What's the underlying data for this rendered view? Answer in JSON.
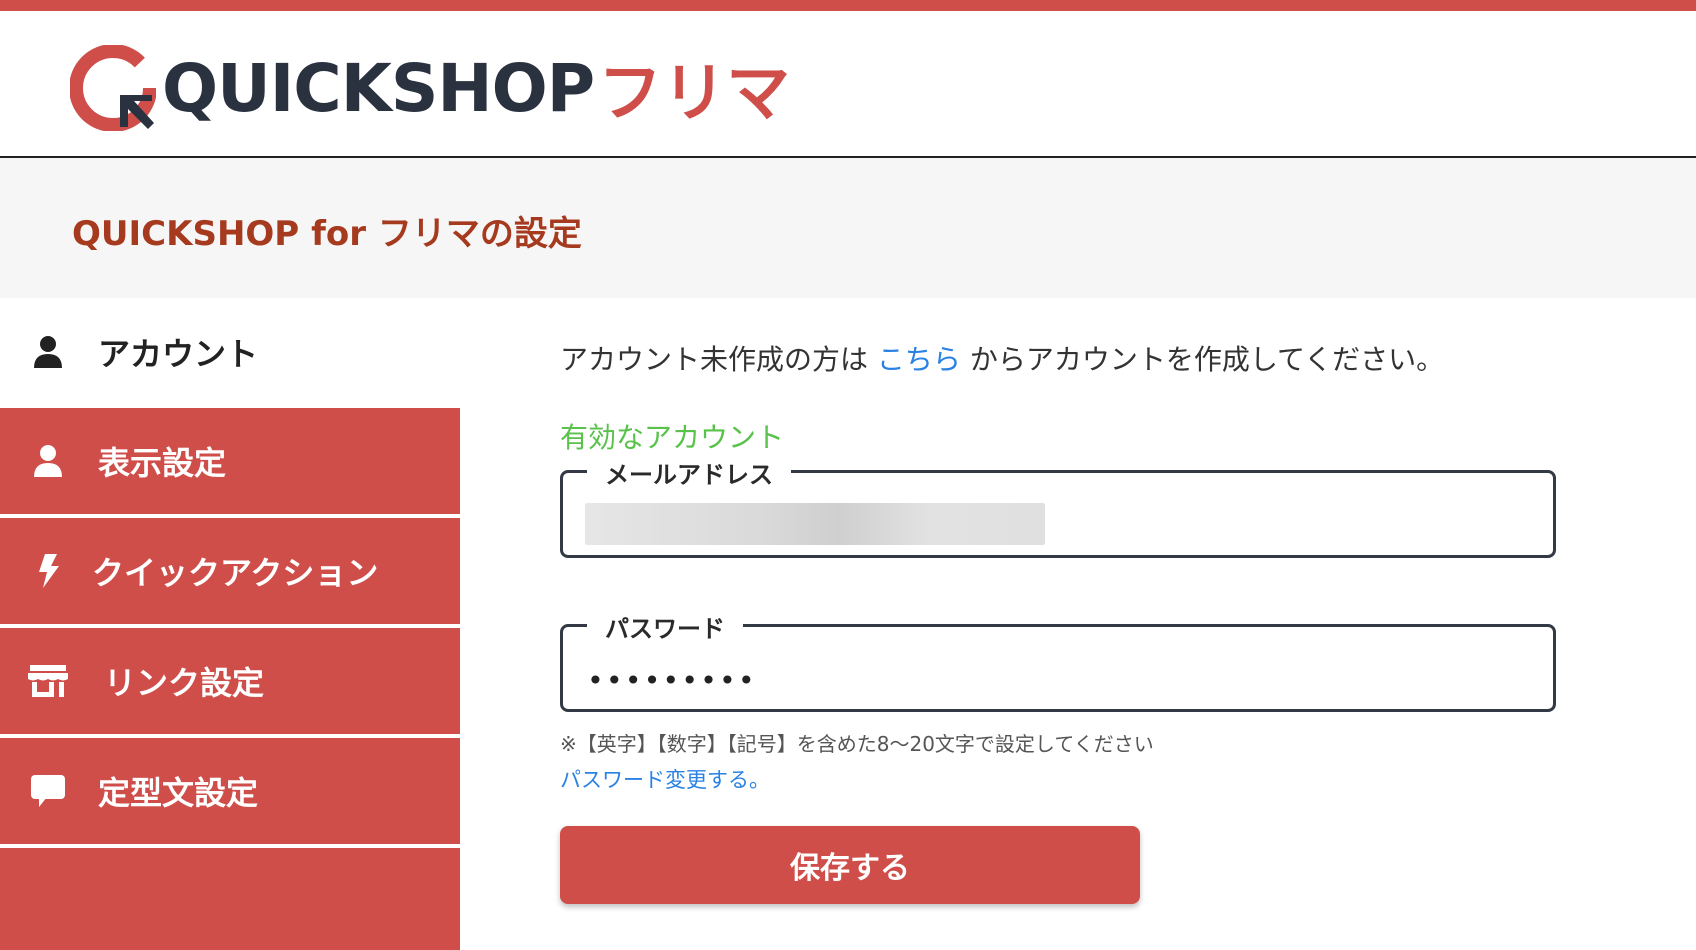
{
  "colors": {
    "brand_red": "#cf4e4a",
    "title_red": "#a63a1e",
    "link_blue": "#2a82e4",
    "valid_green": "#58c24a",
    "dark": "#2a3240"
  },
  "header": {
    "logo_text": "QUICKSHOP",
    "logo_sub": "フリマ"
  },
  "settings": {
    "title": "QUICKSHOP for フリマの設定"
  },
  "sidebar": {
    "items": [
      {
        "label": "アカウント",
        "icon": "user-icon",
        "active": true
      },
      {
        "label": "表示設定",
        "icon": "user-icon"
      },
      {
        "label": "クイックアクション",
        "icon": "lightning-icon"
      },
      {
        "label": "リンク設定",
        "icon": "store-icon"
      },
      {
        "label": "定型文設定",
        "icon": "speech-bubble-icon"
      }
    ]
  },
  "main": {
    "intro_before": "アカウント未作成の方は ",
    "intro_link": "こちら",
    "intro_after": " からアカウントを作成してください。",
    "valid_account": "有効なアカウント",
    "email": {
      "label": "メールアドレス",
      "value": ""
    },
    "password": {
      "label": "パスワード",
      "value": "•••••••••"
    },
    "hint": "※【英字】【数字】【記号】を含めた8〜20文字で設定してください",
    "change_password": "パスワード変更する。",
    "save_label": "保存する"
  }
}
